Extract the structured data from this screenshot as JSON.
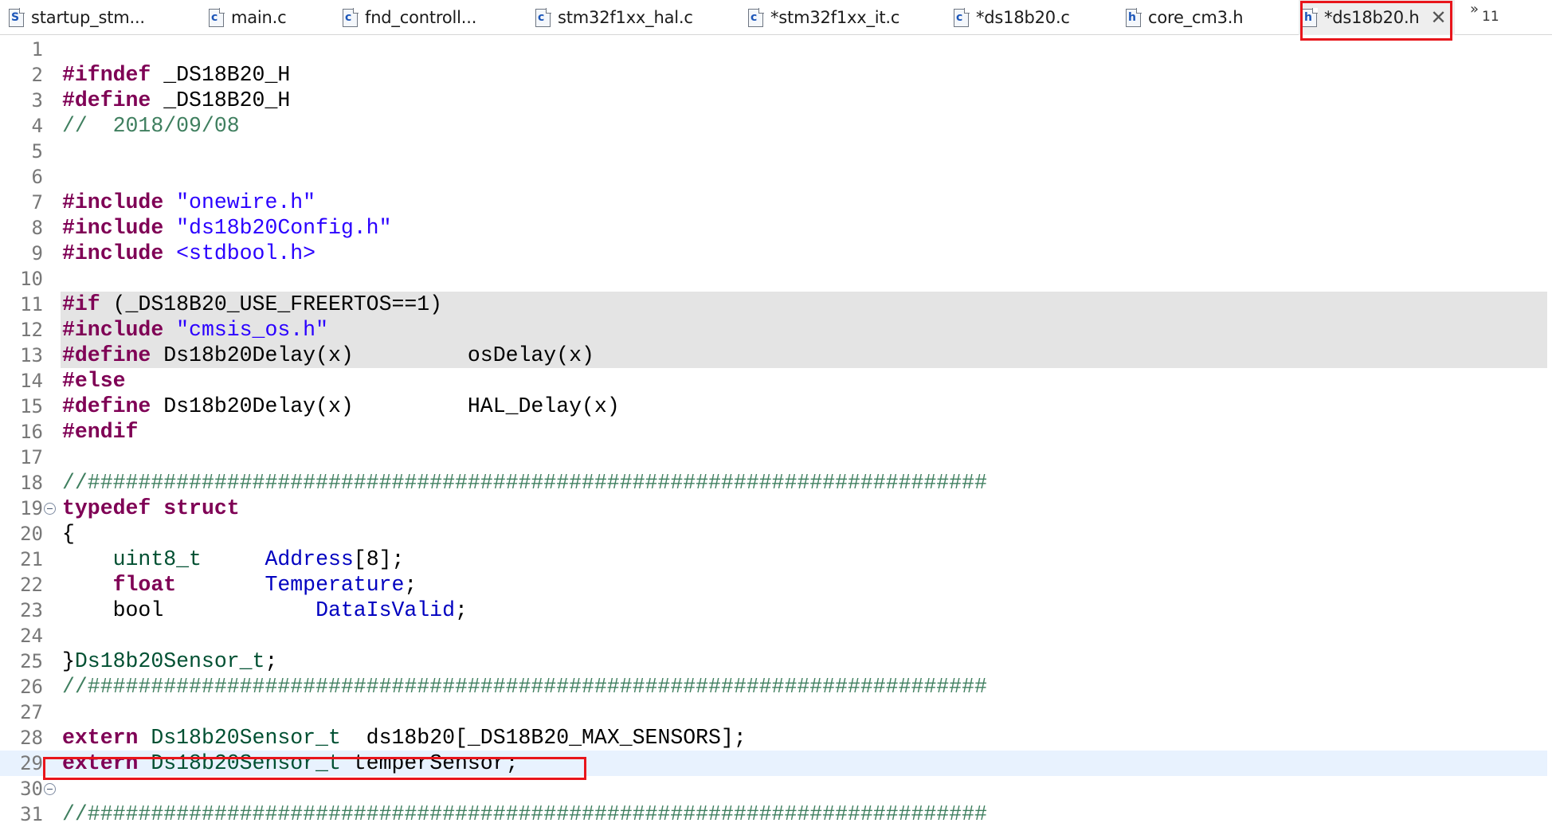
{
  "tabs": [
    {
      "letter": "S",
      "letter_color": "#1c56b8",
      "label": "startup_stm...",
      "active": false
    },
    {
      "letter": "c",
      "letter_color": "#1c56b8",
      "label": "main.c",
      "active": false
    },
    {
      "letter": "c",
      "letter_color": "#1c56b8",
      "label": "fnd_controll...",
      "active": false
    },
    {
      "letter": "c",
      "letter_color": "#1c56b8",
      "label": "stm32f1xx_hal.c",
      "active": false
    },
    {
      "letter": "c",
      "letter_color": "#1c56b8",
      "label": "*stm32f1xx_it.c",
      "active": false
    },
    {
      "letter": "c",
      "letter_color": "#1c56b8",
      "label": "*ds18b20.c",
      "active": false
    },
    {
      "letter": "h",
      "letter_color": "#1c56b8",
      "label": "core_cm3.h",
      "active": false
    },
    {
      "letter": "h",
      "letter_color": "#1c56b8",
      "label": "*ds18b20.h",
      "active": true,
      "close_glyph": "✕"
    }
  ],
  "overflow": {
    "chevron": "»",
    "count": "11"
  },
  "colors": {
    "keyword": "#7f0055",
    "string": "#2a00ff",
    "comment": "#3f7f5f",
    "field": "#0000c0",
    "type": "#005032",
    "annotation": "#e8151b"
  },
  "lines": [
    {
      "n": "1",
      "segs": []
    },
    {
      "n": "2",
      "segs": [
        [
          "kw",
          "#ifndef"
        ],
        [
          "mac",
          " _DS18B20_H"
        ]
      ]
    },
    {
      "n": "3",
      "segs": [
        [
          "kw",
          "#define"
        ],
        [
          "mac",
          " _DS18B20_H"
        ]
      ]
    },
    {
      "n": "4",
      "segs": [
        [
          "cmt",
          "//  2018/09/08"
        ]
      ]
    },
    {
      "n": "5",
      "segs": []
    },
    {
      "n": "6",
      "segs": []
    },
    {
      "n": "7",
      "segs": [
        [
          "kw",
          "#include"
        ],
        [
          "",
          " "
        ],
        [
          "str",
          "\"onewire.h\""
        ]
      ]
    },
    {
      "n": "8",
      "segs": [
        [
          "kw",
          "#include"
        ],
        [
          "",
          " "
        ],
        [
          "str",
          "\"ds18b20Config.h\""
        ]
      ]
    },
    {
      "n": "9",
      "segs": [
        [
          "kw",
          "#include"
        ],
        [
          "",
          " "
        ],
        [
          "str",
          "<stdbool.h>"
        ]
      ]
    },
    {
      "n": "10",
      "segs": []
    },
    {
      "n": "11",
      "inactive": true,
      "segs": [
        [
          "kw",
          "#if"
        ],
        [
          "",
          " (_DS18B20_USE_FREERTOS==1)"
        ]
      ]
    },
    {
      "n": "12",
      "inactive": true,
      "segs": [
        [
          "kw",
          "#include"
        ],
        [
          "",
          " "
        ],
        [
          "str",
          "\"cmsis_os.h\""
        ]
      ]
    },
    {
      "n": "13",
      "inactive": true,
      "segs": [
        [
          "kw",
          "#define"
        ],
        [
          "mac",
          " Ds18b20Delay(x)         osDelay(x)"
        ]
      ]
    },
    {
      "n": "14",
      "segs": [
        [
          "kw",
          "#else"
        ]
      ]
    },
    {
      "n": "15",
      "segs": [
        [
          "kw",
          "#define"
        ],
        [
          "mac",
          " Ds18b20Delay(x)         HAL_Delay(x)"
        ]
      ]
    },
    {
      "n": "16",
      "segs": [
        [
          "kw",
          "#endif"
        ]
      ]
    },
    {
      "n": "17",
      "segs": []
    },
    {
      "n": "18",
      "segs": [
        [
          "cmt",
          "//#######################################################################"
        ]
      ]
    },
    {
      "n": "19",
      "fold": true,
      "segs": [
        [
          "kw",
          "typedef"
        ],
        [
          "",
          " "
        ],
        [
          "kw",
          "struct"
        ]
      ]
    },
    {
      "n": "20",
      "segs": [
        [
          "",
          "{"
        ]
      ]
    },
    {
      "n": "21",
      "segs": [
        [
          "",
          "    "
        ],
        [
          "typ",
          "uint8_t"
        ],
        [
          "",
          "     "
        ],
        [
          "fld",
          "Address"
        ],
        [
          "",
          "[8];"
        ]
      ]
    },
    {
      "n": "22",
      "segs": [
        [
          "",
          "    "
        ],
        [
          "kw",
          "float"
        ],
        [
          "",
          "       "
        ],
        [
          "fld",
          "Temperature"
        ],
        [
          "",
          ";"
        ]
      ]
    },
    {
      "n": "23",
      "segs": [
        [
          "",
          "    bool            "
        ],
        [
          "fld",
          "DataIsValid"
        ],
        [
          "",
          ";"
        ]
      ]
    },
    {
      "n": "24",
      "segs": []
    },
    {
      "n": "25",
      "segs": [
        [
          "",
          "}"
        ],
        [
          "typ",
          "Ds18b20Sensor_t"
        ],
        [
          "",
          ";"
        ]
      ]
    },
    {
      "n": "26",
      "segs": [
        [
          "cmt",
          "//#######################################################################"
        ]
      ]
    },
    {
      "n": "27",
      "segs": []
    },
    {
      "n": "28",
      "segs": [
        [
          "kw",
          "extern"
        ],
        [
          "",
          " "
        ],
        [
          "typ",
          "Ds18b20Sensor_t"
        ],
        [
          "",
          "  ds18b20[_DS18B20_MAX_SENSORS];"
        ]
      ]
    },
    {
      "n": "29",
      "current": true,
      "segs": [
        [
          "kw",
          "extern"
        ],
        [
          "",
          " "
        ],
        [
          "typ",
          "Ds18b20Sensor_t"
        ],
        [
          "",
          " temperSensor;"
        ]
      ]
    },
    {
      "n": "30",
      "fold": true,
      "segs": []
    },
    {
      "n": "31",
      "segs": [
        [
          "cmt",
          "//#######################################################################"
        ]
      ]
    }
  ]
}
